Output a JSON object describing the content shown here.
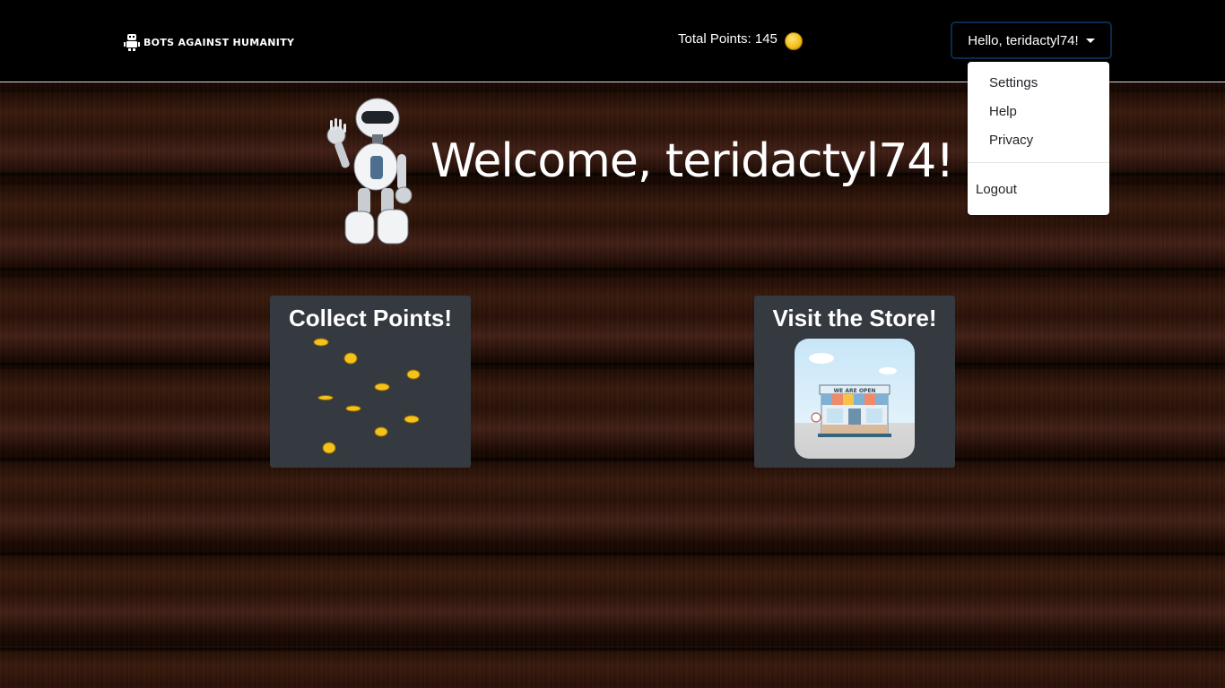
{
  "navbar": {
    "brand_text": "BOTS AGAINST HUMANITY",
    "points_label": "Total Points: 145",
    "user_button_label": "Hello, teridactyl74!"
  },
  "dropdown": {
    "items": [
      "Settings",
      "Help",
      "Privacy"
    ],
    "logout_label": "Logout"
  },
  "hero": {
    "welcome_text": "Welcome, teridactyl74!"
  },
  "cards": {
    "collect_title": "Collect Points!",
    "store_title": "Visit the Store!",
    "store_sign": "WE ARE OPEN"
  },
  "colors": {
    "navbar_bg": "#000000",
    "card_bg": "#343a40",
    "coin_gold": "#f4c21c",
    "user_button_border": "#0c2a4d"
  },
  "icons": {
    "brand": "robot-icon",
    "points": "coin-icon",
    "user_menu": "caret-down-icon"
  }
}
